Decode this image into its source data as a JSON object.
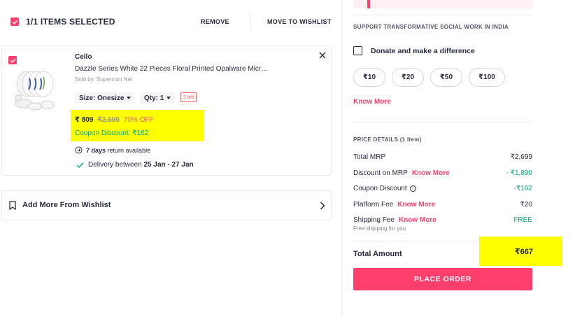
{
  "selection": {
    "label": "1/1 ITEMS SELECTED",
    "remove": "REMOVE",
    "move_to_wishlist": "MOVE TO WISHLIST"
  },
  "item": {
    "brand": "Cello",
    "name": "Dazzle Series White 22 Pieces Floral Printed Opalware Micr…",
    "seller": "Sold by: Supercom Net",
    "size": "Size: Onesize",
    "qty": "Qty: 1",
    "stock": "2 left",
    "price": "₹ 809",
    "mrp": "₹2,699",
    "discount": "70% OFF",
    "coupon": "Coupon Discount: ₹162",
    "return_days": "7 days",
    "return_text": " return available",
    "delivery_prefix": "Delivery between ",
    "delivery_dates": "25 Jan - 27 Jan"
  },
  "wishlist": {
    "label": "Add More From Wishlist"
  },
  "donation": {
    "title": "SUPPORT TRANSFORMATIVE SOCIAL WORK IN INDIA",
    "checkbox_label": "Donate and make a difference",
    "amounts": [
      "₹10",
      "₹20",
      "₹50",
      "₹100"
    ],
    "know_more": "Know More"
  },
  "price_details": {
    "title": "PRICE DETAILS (1 Item)",
    "total_mrp_label": "Total MRP",
    "total_mrp_value": "₹2,699",
    "discount_label": "Discount on MRP",
    "discount_value": "- ₹1,890",
    "coupon_label": "Coupon Discount",
    "coupon_value": "-₹162",
    "platform_label": "Platform Fee",
    "platform_value": "₹20",
    "shipping_label": "Shipping Fee",
    "shipping_value": "FREE",
    "shipping_note": "Free shipping for you",
    "know_more": "Know More",
    "total_label": "Total Amount",
    "total_value": "₹667"
  },
  "actions": {
    "place_order": "PLACE ORDER"
  },
  "colors": {
    "accent": "#ff3f6c",
    "success": "#03a685",
    "highlight": "#ffff00",
    "warning": "#f16565"
  }
}
